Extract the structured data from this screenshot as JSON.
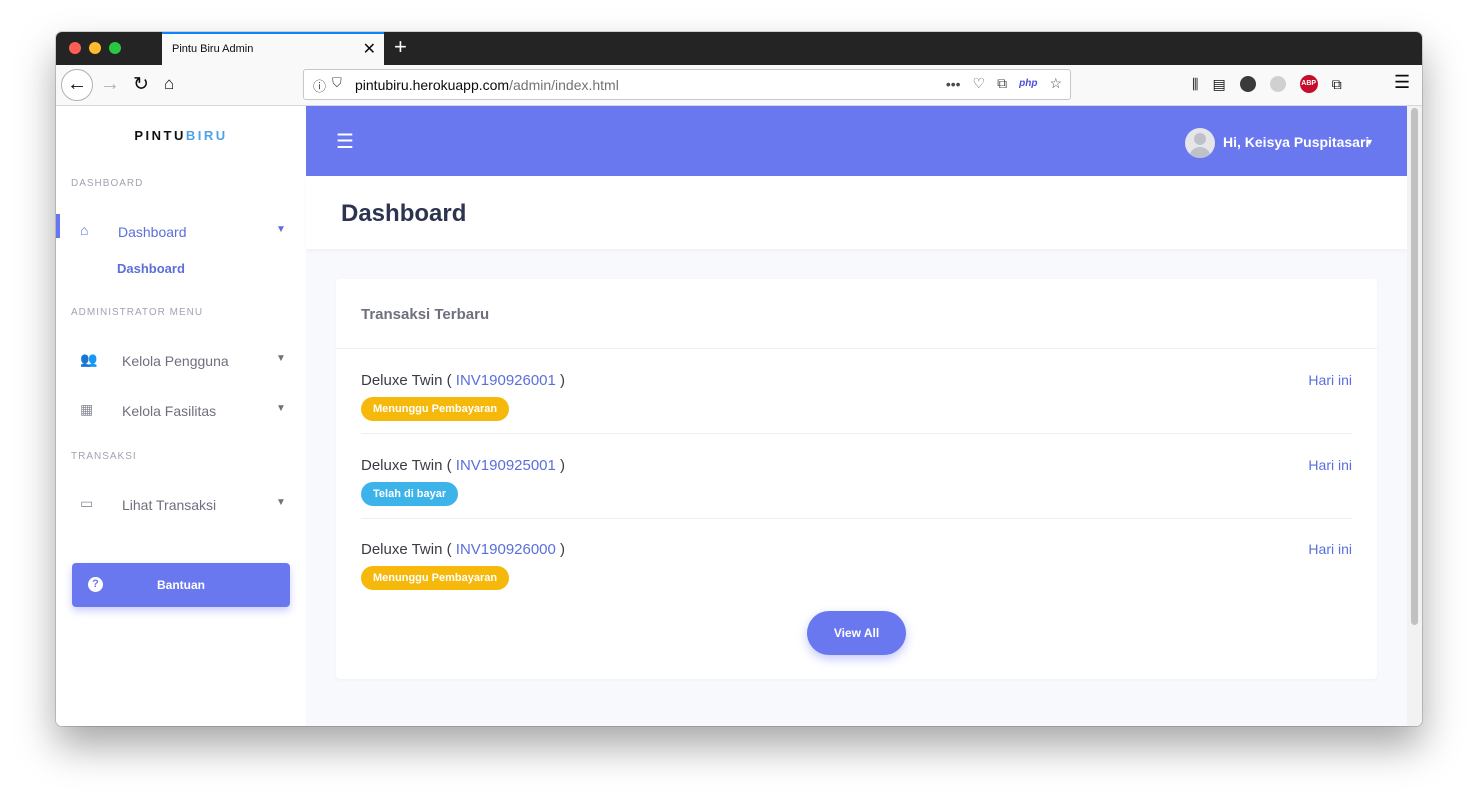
{
  "browser": {
    "tab_title": "Pintu Biru Admin",
    "tab_close": "✕",
    "new_tab": "+",
    "url_host": "pintubiru.herokuapp.com",
    "url_path": "/admin/index.html",
    "url_more": "•••",
    "php_label": "php",
    "abp_label": "ABP"
  },
  "sidebar": {
    "brand_part1": "PINTU",
    "brand_part2": "BIRU",
    "section_dashboard": "DASHBOARD",
    "dashboard_item": "Dashboard",
    "dashboard_sub": "Dashboard",
    "section_admin": "ADMINISTRATOR MENU",
    "kelola_pengguna": "Kelola Pengguna",
    "kelola_fasilitas": "Kelola Fasilitas",
    "section_transaksi": "TRANSAKSI",
    "lihat_transaksi": "Lihat Transaksi",
    "help_label": "Bantuan",
    "help_icon": "?"
  },
  "topbar": {
    "user_greeting": "Hi, Keisya Puspitasari"
  },
  "page": {
    "title": "Dashboard"
  },
  "card": {
    "title": "Transaksi Terbaru",
    "transactions": [
      {
        "room": "Deluxe Twin",
        "invoice": "INV190926001",
        "when": "Hari ini",
        "status": "Menunggu Pembayaran",
        "status_color": "#f6b90b"
      },
      {
        "room": "Deluxe Twin",
        "invoice": "INV190925001",
        "when": "Hari ini",
        "status": "Telah di bayar",
        "status_color": "#3cb4ea"
      },
      {
        "room": "Deluxe Twin",
        "invoice": "INV190926000",
        "when": "Hari ini",
        "status": "Menunggu Pembayaran",
        "status_color": "#f6b90b"
      }
    ],
    "view_all": "View All"
  },
  "colors": {
    "accent": "#6a78f0",
    "link": "#5a6fdb",
    "waiting": "#f6b90b",
    "paid": "#3cb4ea"
  }
}
